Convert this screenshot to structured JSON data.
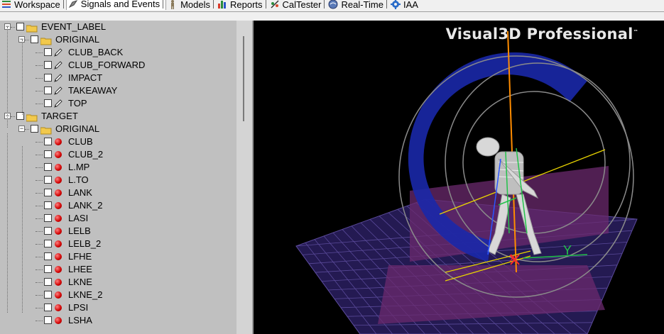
{
  "tabs": [
    {
      "label": "Workspace",
      "icon": "workspace-icon",
      "active": false
    },
    {
      "label": "Signals and Events",
      "icon": "signals-icon",
      "active": true
    },
    {
      "label": "Models",
      "icon": "models-icon",
      "active": false
    },
    {
      "label": "Reports",
      "icon": "reports-icon",
      "active": false
    },
    {
      "label": "CalTester",
      "icon": "caltester-icon",
      "active": false
    },
    {
      "label": "Real-Time",
      "icon": "realtime-icon",
      "active": false
    },
    {
      "label": "IAA",
      "icon": "gear-icon",
      "active": false
    }
  ],
  "tree": {
    "event_label": {
      "label": "EVENT_LABEL",
      "original": {
        "label": "ORIGINAL",
        "items": [
          "CLUB_BACK",
          "CLUB_FORWARD",
          "IMPACT",
          "TAKEAWAY",
          "TOP"
        ]
      }
    },
    "target": {
      "label": "TARGET",
      "original": {
        "label": "ORIGINAL",
        "items": [
          "CLUB",
          "CLUB_2",
          "L.MP",
          "L.TO",
          "LANK",
          "LANK_2",
          "LASI",
          "LELB",
          "LELB_2",
          "LFHE",
          "LHEE",
          "LKNE",
          "LKNE_2",
          "LPSI",
          "LSHA"
        ]
      }
    }
  },
  "viewport": {
    "brand": "Visual3D Professional",
    "trademark": "™",
    "axis_x_label": "X",
    "axis_y_label": "Y",
    "colors": {
      "grid": "#5a4a9a",
      "ring": "#1a28a8",
      "plane": "#6b2a6e",
      "shaft": "#ff8c00"
    }
  }
}
